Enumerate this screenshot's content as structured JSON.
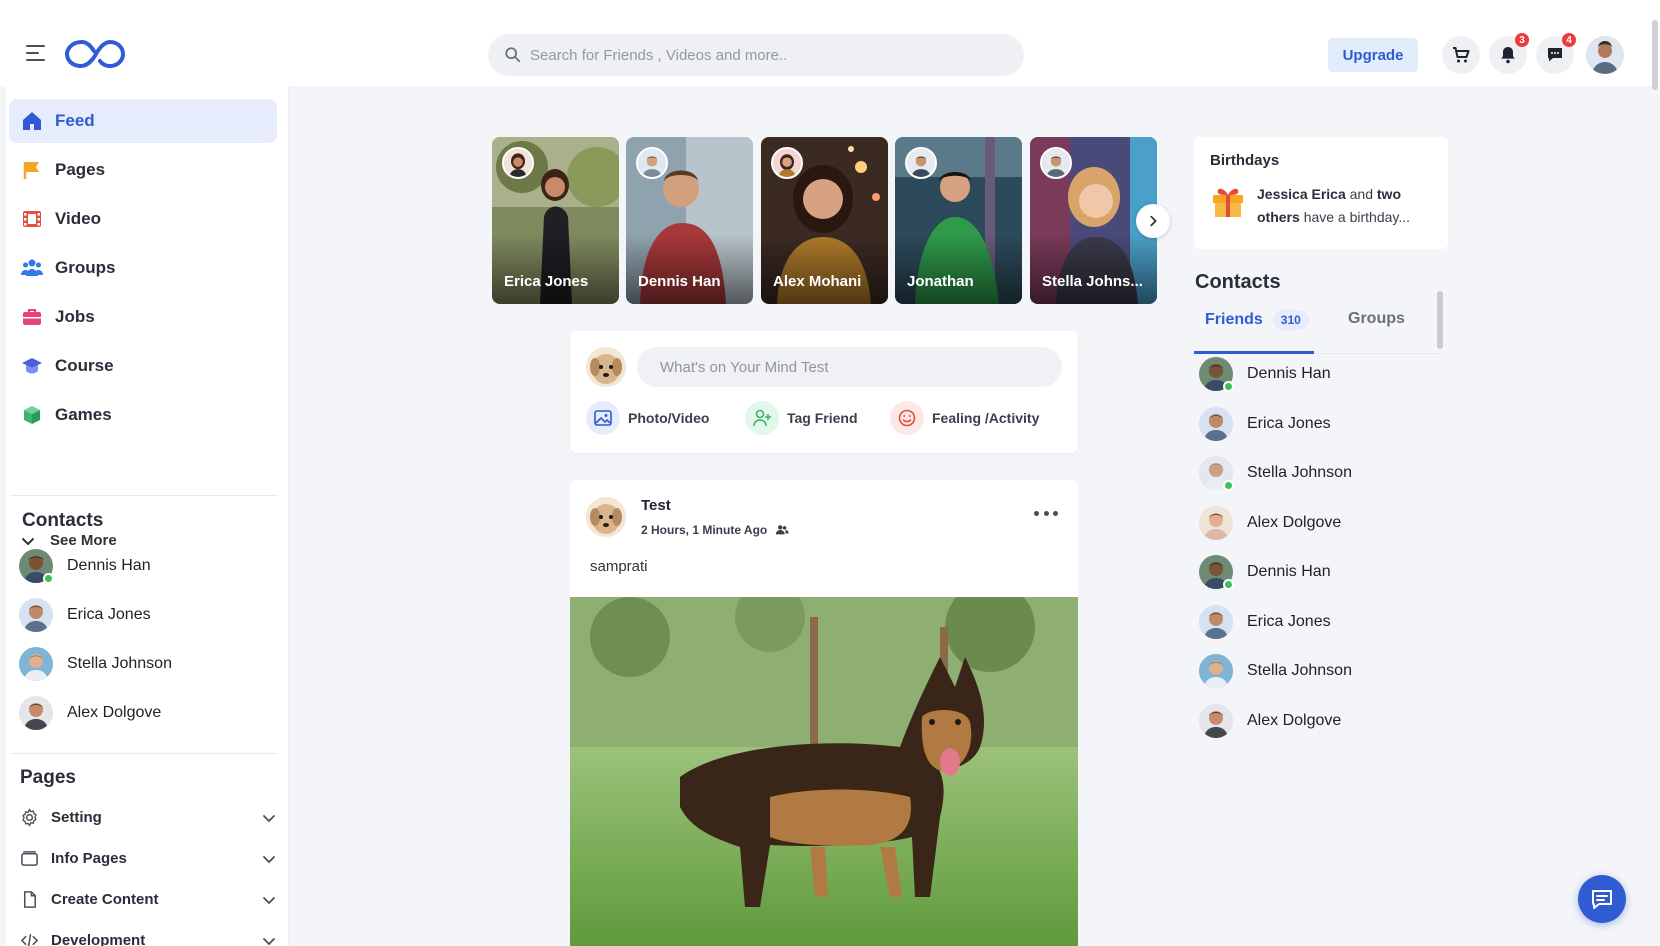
{
  "header": {
    "search_placeholder": "Search for Friends , Videos and more..",
    "upgrade_label": "Upgrade",
    "notifications_count": "3",
    "messages_count": "4"
  },
  "sidebar": {
    "nav": [
      {
        "label": "Feed",
        "icon": "home-icon",
        "color": "#2f5bd3"
      },
      {
        "label": "Pages",
        "icon": "flag-icon",
        "color": "#f5a623"
      },
      {
        "label": "Video",
        "icon": "film-icon",
        "color": "#e44d3a"
      },
      {
        "label": "Groups",
        "icon": "users-icon",
        "color": "#2f7be0"
      },
      {
        "label": "Jobs",
        "icon": "briefcase-icon",
        "color": "#e8427c"
      },
      {
        "label": "Course",
        "icon": "graduation-cap-icon",
        "color": "#4a5fd8"
      },
      {
        "label": "Games",
        "icon": "cube-icon",
        "color": "#3cb371"
      }
    ],
    "see_more": "See More",
    "contacts_title": "Contacts",
    "contacts": [
      {
        "name": "Dennis Han",
        "online": true
      },
      {
        "name": "Erica Jones",
        "online": false
      },
      {
        "name": "Stella Johnson",
        "online": false
      },
      {
        "name": "Alex Dolgove",
        "online": false
      }
    ],
    "pages_title": "Pages",
    "pages": [
      {
        "label": "Setting",
        "icon": "gear-icon"
      },
      {
        "label": "Info Pages",
        "icon": "window-icon"
      },
      {
        "label": "Create Content",
        "icon": "file-icon"
      },
      {
        "label": "Development",
        "icon": "code-icon"
      }
    ]
  },
  "stories": [
    {
      "name": "Erica Jones"
    },
    {
      "name": "Dennis Han"
    },
    {
      "name": "Alex Mohani"
    },
    {
      "name": "Jonathan"
    },
    {
      "name": "Stella Johns..."
    }
  ],
  "composer": {
    "placeholder": "What's on Your Mind Test",
    "actions": [
      "Photo/Video",
      "Tag Friend",
      "Fealing /Activity"
    ]
  },
  "post": {
    "author": "Test",
    "time": "2 Hours, 1 Minute Ago",
    "text": "samprati"
  },
  "birthdays": {
    "title": "Birthdays",
    "name": "Jessica Erica",
    "and": "and",
    "others": "two others",
    "suffix": "have a birthday..."
  },
  "right_contacts": {
    "title": "Contacts",
    "tab_friends": "Friends",
    "friends_count": "310",
    "tab_groups": "Groups",
    "items": [
      {
        "name": "Dennis Han",
        "online": true
      },
      {
        "name": "Erica Jones",
        "online": false
      },
      {
        "name": "Stella Johnson",
        "online": true
      },
      {
        "name": "Alex Dolgove",
        "online": false
      },
      {
        "name": "Dennis Han",
        "online": true
      },
      {
        "name": "Erica Jones",
        "online": false
      },
      {
        "name": "Stella Johnson",
        "online": false
      },
      {
        "name": "Alex Dolgove",
        "online": false
      }
    ]
  },
  "colors": {
    "accent": "#2f5bd3",
    "online": "#3bbf5f",
    "badge": "#ee3b3b"
  }
}
